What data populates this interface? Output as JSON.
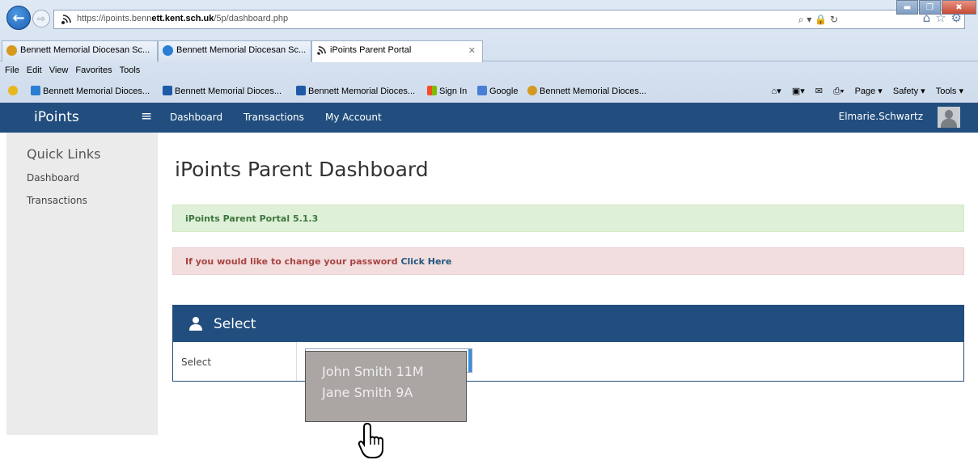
{
  "browser": {
    "url_prefix": "https://ipoints.benn",
    "url_bold": "ett.kent.sch.uk",
    "url_suffix": "/5p/dashboard.php",
    "url_tools": "⌕ ▾ 🔒 ↻",
    "right_icons": "⌂☆⚙",
    "tabs": [
      {
        "label": "Bennett Memorial Diocesan Sc...",
        "icon_color": "#d49a1e"
      },
      {
        "label": "Bennett Memorial Diocesan Sc...",
        "icon_color": "#2a7fd4"
      },
      {
        "label": "iPoints Parent Portal",
        "icon_color": "#ffffff",
        "close": "✕"
      }
    ],
    "menu": [
      "File",
      "Edit",
      "View",
      "Favorites",
      "Tools"
    ],
    "favorites": [
      {
        "label": "Bennett Memorial Dioces...",
        "icon_color": "#2a7fd4"
      },
      {
        "label": "Bennett Memorial Dioces...",
        "icon_color": "#1e5aa8"
      },
      {
        "label": "Bennett Memorial Dioces...",
        "icon_color": "#1e5aa8"
      },
      {
        "label": "Sign In",
        "icon_color": "#f25022"
      },
      {
        "label": "Google",
        "icon_color": "#4a7fd8"
      },
      {
        "label": "Bennett Memorial Dioces...",
        "icon_color": "#d49a1e"
      }
    ],
    "command_bar": {
      "page": "Page ▾",
      "safety": "Safety ▾",
      "tools": "Tools ▾"
    }
  },
  "navbar": {
    "brand": "iPoints",
    "menu_icon": "≡",
    "links": [
      "Dashboard",
      "Transactions",
      "My Account"
    ],
    "user": "Elmarie.Schwartz"
  },
  "sidebar": {
    "title": "Quick Links",
    "items": [
      "Dashboard",
      "Transactions"
    ]
  },
  "main": {
    "title": "iPoints Parent Dashboard",
    "version_alert": "iPoints Parent Portal 5.1.3",
    "password_alert_text": "If you would like to change your password ",
    "password_alert_link": "Click Here"
  },
  "select_panel": {
    "title": "Select",
    "row_label": "Select",
    "options": [
      "John Smith 11M",
      "Jane Smith 9A"
    ]
  },
  "colors": {
    "navbar": "#214e7e",
    "success_bg": "#dff0d8",
    "danger_bg": "#f2dede",
    "dropdown_bg": "#aba6a4"
  }
}
